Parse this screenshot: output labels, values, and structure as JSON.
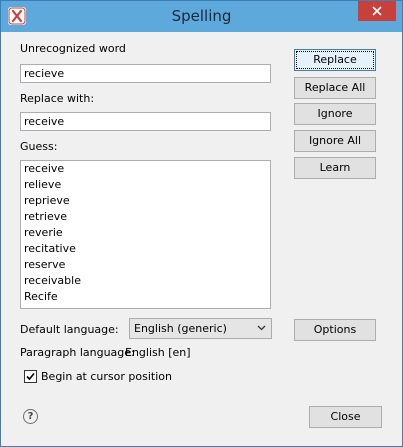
{
  "window": {
    "title": "Spelling"
  },
  "form": {
    "unrecognized_label": "Unrecognized word",
    "unrecognized_value": "recieve",
    "replace_label": "Replace with:",
    "replace_value": "receive",
    "guess_label": "Guess:",
    "guesses": [
      "receive",
      "relieve",
      "reprieve",
      "retrieve",
      "reverie",
      "recitative",
      "reserve",
      "receivable",
      "Recife"
    ],
    "default_language_label": "Default language:",
    "default_language_value": "English (generic)",
    "paragraph_language_label": "Paragraph language:",
    "paragraph_language_value": "English [en]",
    "begin_at_cursor_label": "Begin at cursor position",
    "begin_at_cursor_checked": true
  },
  "buttons": {
    "replace": "Replace",
    "replace_all": "Replace All",
    "ignore": "Ignore",
    "ignore_all": "Ignore All",
    "learn": "Learn",
    "options": "Options",
    "close": "Close"
  },
  "icons": {
    "app": "app-x-icon",
    "window_close": "close-icon",
    "help": "help-icon",
    "dropdown": "chevron-down-icon",
    "check": "check-icon"
  },
  "colors": {
    "titlebar": "#5ea9dc",
    "close_button": "#c7403a",
    "default_button_border": "#3c7fb1",
    "app_icon": "#d03a3a"
  }
}
